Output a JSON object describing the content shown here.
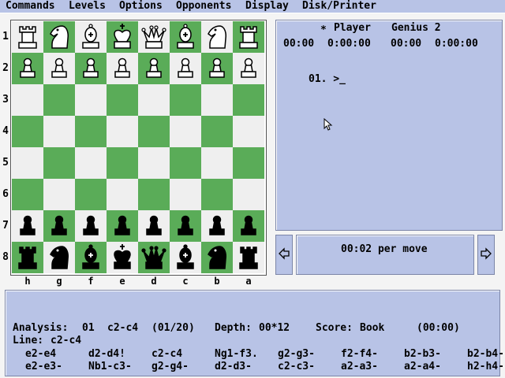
{
  "menu": {
    "commands": "Commands",
    "levels": "Levels",
    "options": "Options",
    "opponents": "Opponents",
    "display": "Display",
    "disk_printer": "Disk/Printer"
  },
  "board": {
    "ranks": [
      "1",
      "2",
      "3",
      "4",
      "5",
      "6",
      "7",
      "8"
    ],
    "files": [
      "h",
      "g",
      "f",
      "e",
      "d",
      "c",
      "b",
      "a"
    ],
    "rows": [
      [
        {
          "piece": "rook",
          "color": "white"
        },
        {
          "piece": "knight",
          "color": "white"
        },
        {
          "piece": "bishop",
          "color": "white"
        },
        {
          "piece": "king",
          "color": "white"
        },
        {
          "piece": "queen",
          "color": "white"
        },
        {
          "piece": "bishop",
          "color": "white"
        },
        {
          "piece": "knight",
          "color": "white"
        },
        {
          "piece": "rook",
          "color": "white"
        }
      ],
      [
        {
          "piece": "pawn",
          "color": "white"
        },
        {
          "piece": "pawn",
          "color": "white"
        },
        {
          "piece": "pawn",
          "color": "white"
        },
        {
          "piece": "pawn",
          "color": "white"
        },
        {
          "piece": "pawn",
          "color": "white"
        },
        {
          "piece": "pawn",
          "color": "white"
        },
        {
          "piece": "pawn",
          "color": "white"
        },
        {
          "piece": "pawn",
          "color": "white"
        }
      ],
      [
        null,
        null,
        null,
        null,
        null,
        null,
        null,
        null
      ],
      [
        null,
        null,
        null,
        null,
        null,
        null,
        null,
        null
      ],
      [
        null,
        null,
        null,
        null,
        null,
        null,
        null,
        null
      ],
      [
        null,
        null,
        null,
        null,
        null,
        null,
        null,
        null
      ],
      [
        {
          "piece": "pawn",
          "color": "black"
        },
        {
          "piece": "pawn",
          "color": "black"
        },
        {
          "piece": "pawn",
          "color": "black"
        },
        {
          "piece": "pawn",
          "color": "black"
        },
        {
          "piece": "pawn",
          "color": "black"
        },
        {
          "piece": "pawn",
          "color": "black"
        },
        {
          "piece": "pawn",
          "color": "black"
        },
        {
          "piece": "pawn",
          "color": "black"
        }
      ],
      [
        {
          "piece": "rook",
          "color": "black"
        },
        {
          "piece": "knight",
          "color": "black"
        },
        {
          "piece": "bishop",
          "color": "black"
        },
        {
          "piece": "king",
          "color": "black"
        },
        {
          "piece": "queen",
          "color": "black"
        },
        {
          "piece": "bishop",
          "color": "black"
        },
        {
          "piece": "knight",
          "color": "black"
        },
        {
          "piece": "rook",
          "color": "black"
        }
      ]
    ],
    "light_color": "#efefef",
    "dark_color": "#5aac58"
  },
  "players": {
    "marker": "∗",
    "player_label": "Player",
    "opponent_label": "Genius 2",
    "player_time_short": "00:00",
    "player_time_long": "0:00:00",
    "opponent_time_short": "00:00",
    "opponent_time_long": "0:00:00"
  },
  "moves": {
    "line": "01. >_"
  },
  "time_control": {
    "text": "00:02 per move",
    "prev_icon": "left-arrow-icon",
    "next_icon": "right-arrow-icon"
  },
  "analysis": {
    "label": "Analysis:",
    "move_no": "01",
    "move": "c2-c4",
    "count": "(01/20)",
    "depth_label": "Depth:",
    "depth": "00*12",
    "score_label": "Score:",
    "score": "Book",
    "time": "(00:00)",
    "line_label": "Line:",
    "line": "c2-c4",
    "candidates_row1": [
      "e2-e4",
      "d2-d4!",
      "c2-c4",
      "Ng1-f3.",
      "g2-g3-",
      "f2-f4-",
      "b2-b3-",
      "b2-b4-"
    ],
    "candidates_row2": [
      "e2-e3-",
      "Nb1-c3-",
      "g2-g4-",
      "d2-d3-",
      "c2-c3-",
      "a2-a3-",
      "a2-a4-",
      "h2-h4-"
    ]
  },
  "colors": {
    "panel": "#b8c3e6",
    "menubar": "#b8c3e6"
  }
}
